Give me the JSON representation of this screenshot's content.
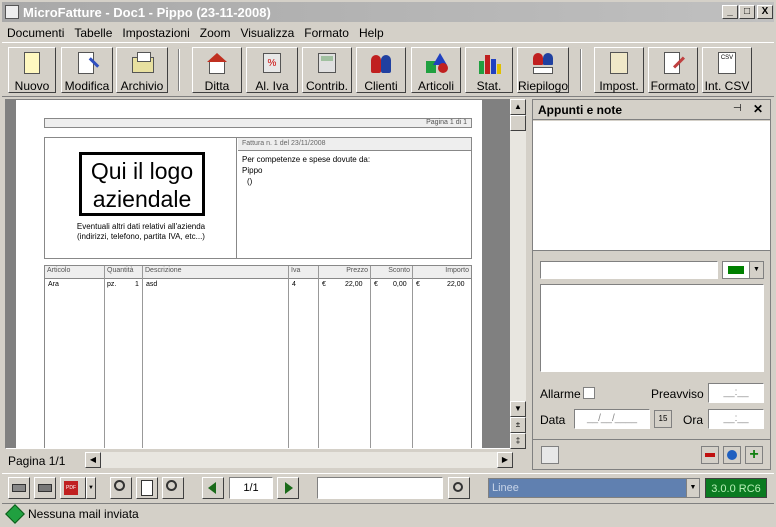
{
  "window": {
    "title": "MicroFatture - Doc1 - Pippo (23-11-2008)",
    "min": "_",
    "max": "□",
    "close": "X"
  },
  "menu": [
    "Documenti",
    "Tabelle",
    "Impostazioni",
    "Zoom",
    "Visualizza",
    "Formato",
    "Help"
  ],
  "toolbar": {
    "nuovo": "Nuovo",
    "modifica": "Modifica",
    "archivio": "Archivio",
    "ditta": "Ditta",
    "aliva": "Al. Iva",
    "contrib": "Contrib.",
    "clienti": "Clienti",
    "articoli": "Articoli",
    "stat": "Stat.",
    "riepilogo": "Riepilogo",
    "impost": "Impost.",
    "formato": "Formato",
    "intcsv": "Int. CSV"
  },
  "doc": {
    "page_label": "Pagina 1 di 1",
    "logo_line1": "Qui il logo",
    "logo_line2": "aziendale",
    "company_note1": "Eventuali altri dati relativi all'azienda",
    "company_note2": "(indirizzi, telefono, partita IVA, etc...)",
    "invoice_header": "Fattura n. 1 del 23/11/2008",
    "competenze": "Per competenze e spese dovute da:",
    "client_name": "Pippo",
    "client_extra": "()",
    "columns": {
      "articolo": "Articolo",
      "quantita": "Quantità",
      "descrizione": "Descrizione",
      "iva": "Iva",
      "prezzo": "Prezzo",
      "sconto": "Sconto",
      "importo": "Importo"
    },
    "row": {
      "articolo": "Ara",
      "unita": "pz.",
      "quantita": "1",
      "descrizione": "asd",
      "iva": "4",
      "prezzo_cur": "€",
      "prezzo": "22,00",
      "sconto_cur": "€",
      "sconto": "0,00",
      "importo_cur": "€",
      "importo": "22,00"
    }
  },
  "pagebar": {
    "label": "Pagina 1/1"
  },
  "notes": {
    "title": "Appunti e note",
    "pin": "⊣",
    "close": "✕",
    "color": "#008000",
    "allarme": "Allarme",
    "preavviso": "Preavviso",
    "preavviso_value": "__:__",
    "data": "Data",
    "data_value": "__/__/____",
    "ora": "Ora",
    "ora_value": "__:__"
  },
  "bottom": {
    "page_field": "1/1",
    "search_value": "",
    "combo_placeholder": "Linee",
    "version": "3.0.0 RC6"
  },
  "status": {
    "text": "Nessuna mail inviata"
  }
}
